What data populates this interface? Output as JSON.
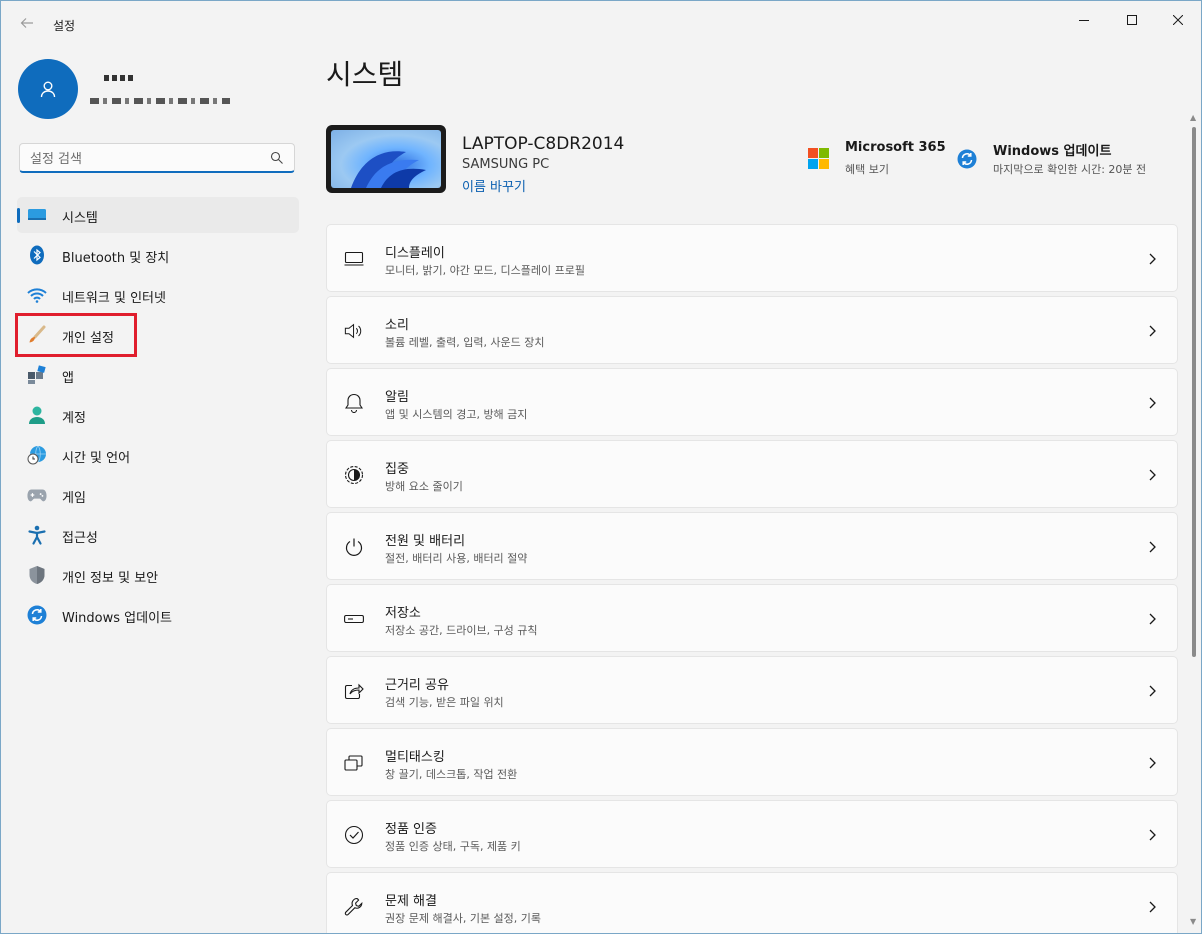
{
  "app": {
    "title": "설정"
  },
  "search": {
    "placeholder": "설정 검색"
  },
  "sidebar": {
    "items": [
      {
        "label": "시스템",
        "icon": "system-icon"
      },
      {
        "label": "Bluetooth 및 장치",
        "icon": "bluetooth-icon"
      },
      {
        "label": "네트워크 및 인터넷",
        "icon": "wifi-icon"
      },
      {
        "label": "개인 설정",
        "icon": "paintbrush-icon"
      },
      {
        "label": "앱",
        "icon": "apps-icon"
      },
      {
        "label": "계정",
        "icon": "account-icon"
      },
      {
        "label": "시간 및 언어",
        "icon": "globe-clock-icon"
      },
      {
        "label": "게임",
        "icon": "gamepad-icon"
      },
      {
        "label": "접근성",
        "icon": "accessibility-icon"
      },
      {
        "label": "개인 정보 및 보안",
        "icon": "shield-icon"
      },
      {
        "label": "Windows 업데이트",
        "icon": "update-icon"
      }
    ],
    "active_index": 0,
    "highlighted_index": 3
  },
  "main": {
    "title": "시스템",
    "device": {
      "name": "LAPTOP-C8DR2014",
      "model": "SAMSUNG PC",
      "rename_label": "이름 바꾸기"
    },
    "promos": [
      {
        "title": "Microsoft 365",
        "subtitle": "혜택 보기",
        "icon": "microsoft-logo-icon"
      },
      {
        "title": "Windows 업데이트",
        "subtitle": "마지막으로 확인한 시간: 20분 전",
        "icon": "update-icon"
      }
    ],
    "cards": [
      {
        "title": "디스플레이",
        "subtitle": "모니터, 밝기, 야간 모드, 디스플레이 프로필",
        "icon": "monitor-icon"
      },
      {
        "title": "소리",
        "subtitle": "볼륨 레벨, 출력, 입력, 사운드 장치",
        "icon": "speaker-icon"
      },
      {
        "title": "알림",
        "subtitle": "앱 및 시스템의 경고, 방해 금지",
        "icon": "bell-icon"
      },
      {
        "title": "집중",
        "subtitle": "방해 요소 줄이기",
        "icon": "focus-icon"
      },
      {
        "title": "전원 및 배터리",
        "subtitle": "절전, 배터리 사용, 배터리 절약",
        "icon": "power-icon"
      },
      {
        "title": "저장소",
        "subtitle": "저장소 공간, 드라이브, 구성 규칙",
        "icon": "storage-icon"
      },
      {
        "title": "근거리 공유",
        "subtitle": "검색 기능, 받은 파일 위치",
        "icon": "share-icon"
      },
      {
        "title": "멀티태스킹",
        "subtitle": "창 끌기, 데스크톱, 작업 전환",
        "icon": "multitask-icon"
      },
      {
        "title": "정품 인증",
        "subtitle": "정품 인증 상태, 구독, 제품 키",
        "icon": "checkmark-circle-icon"
      },
      {
        "title": "문제 해결",
        "subtitle": "권장 문제 해결사, 기본 설정, 기록",
        "icon": "wrench-icon"
      }
    ]
  },
  "colors": {
    "accent": "#0f6cbd",
    "highlight": "#e01e2d",
    "background": "#f3f3f3"
  }
}
